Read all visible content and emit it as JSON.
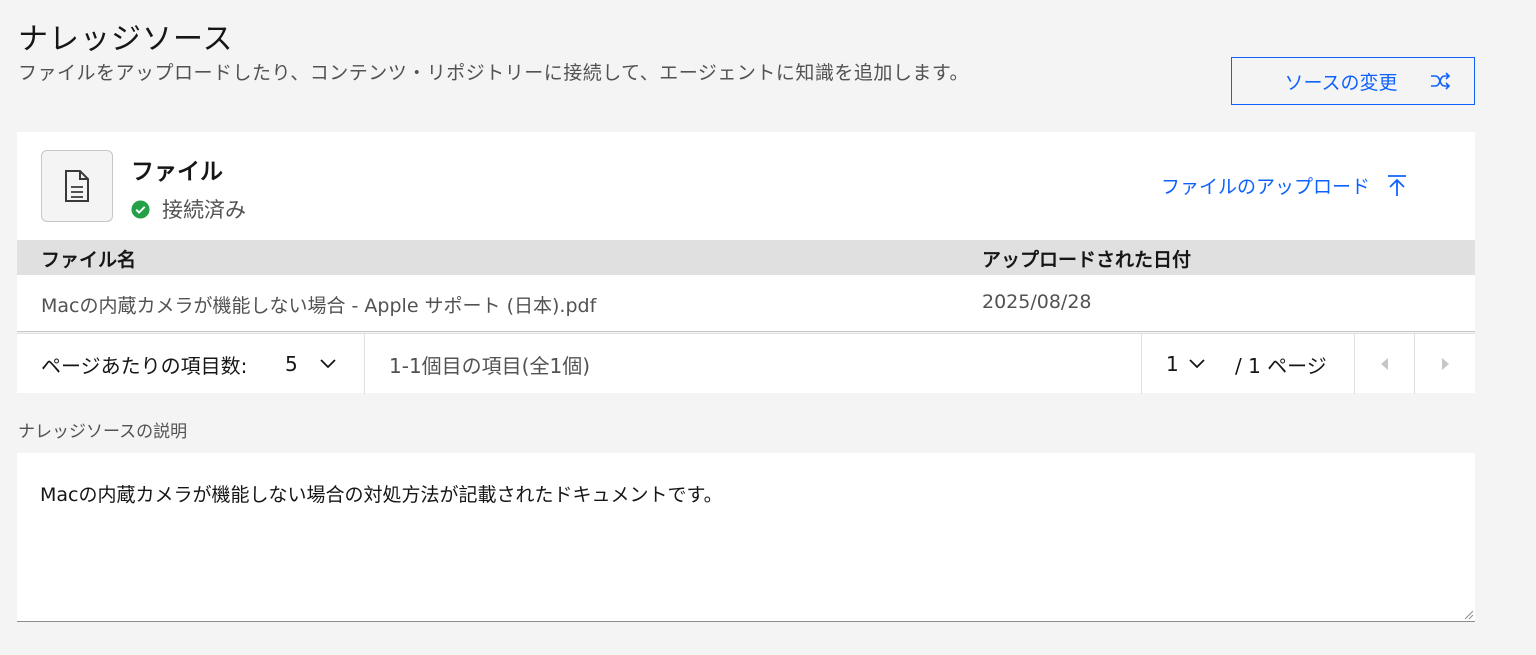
{
  "header": {
    "title": "ナレッジソース",
    "description": "ファイルをアップロードしたり、コンテンツ・リポジトリーに接続して、エージェントに知識を追加します。",
    "change_source_label": "ソースの変更"
  },
  "source_card": {
    "icon": "document-icon",
    "title": "ファイル",
    "status_icon": "checkmark-filled-icon",
    "status_text": "接続済み",
    "status_color": "#24a148",
    "upload_label": "ファイルのアップロード"
  },
  "table": {
    "columns": [
      "ファイル名",
      "アップロードされた日付"
    ],
    "rows": [
      {
        "name": "Macの内蔵カメラが機能しない場合 - Apple サポート (日本).pdf",
        "date": "2025/08/28"
      }
    ]
  },
  "pagination": {
    "items_per_page_label": "ページあたりの項目数:",
    "items_per_page_value": "5",
    "range_text": "1-1個目の項目(全1個)",
    "current_page": "1",
    "total_pages_text": "/ 1 ページ"
  },
  "knowledge_description": {
    "label": "ナレッジソースの説明",
    "value": "Macの内蔵カメラが機能しない場合の対処方法が記載されたドキュメントです。"
  },
  "colors": {
    "accent": "#0f62fe",
    "background": "#f4f4f4",
    "table_header": "#e0e0e0"
  }
}
